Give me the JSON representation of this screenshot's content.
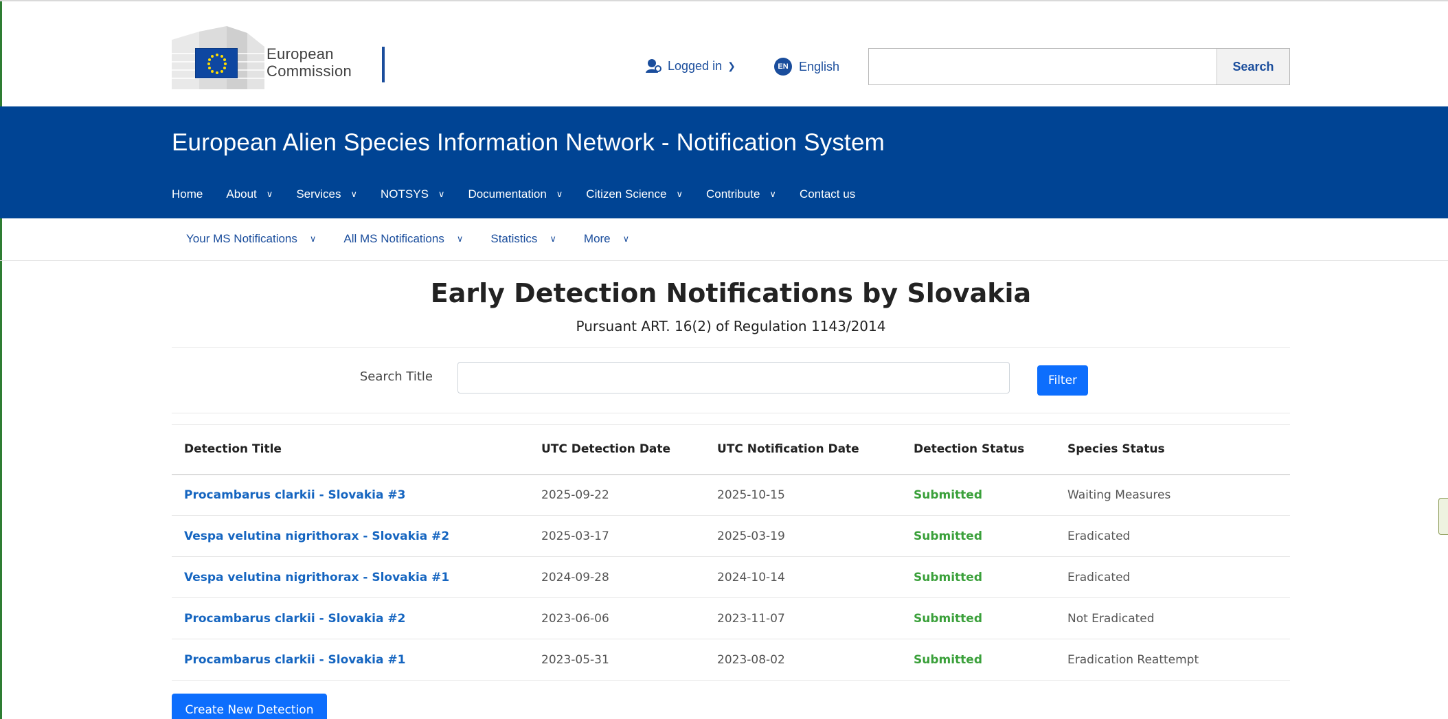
{
  "header": {
    "logo_text_line1": "European",
    "logo_text_line2": "Commission",
    "login_label": "Logged in",
    "lang_badge": "EN",
    "lang_label": "English",
    "search_placeholder": "",
    "search_button": "Search"
  },
  "band": {
    "site_title": "European Alien Species Information Network - Notification System",
    "nav": [
      {
        "label": "Home"
      },
      {
        "label": "About"
      },
      {
        "label": "Services"
      },
      {
        "label": "NOTSYS"
      },
      {
        "label": "Documentation"
      },
      {
        "label": "Citizen Science"
      },
      {
        "label": "Contribute"
      },
      {
        "label": "Contact us"
      }
    ]
  },
  "subnav": [
    {
      "label": "Your MS Notifications"
    },
    {
      "label": "All MS Notifications"
    },
    {
      "label": "Statistics"
    },
    {
      "label": "More"
    }
  ],
  "content": {
    "title": "Early Detection Notifications by Slovakia",
    "subtitle": "Pursuant ART. 16(2) of Regulation 1143/2014",
    "filter_label": "Search Title",
    "filter_placeholder": "",
    "filter_button": "Filter",
    "table": {
      "headers": [
        "Detection Title",
        "UTC Detection Date",
        "UTC Notification Date",
        "Detection Status",
        "Species Status"
      ],
      "rows": [
        [
          "Procambarus clarkii - Slovakia #3",
          "2025-09-22",
          "2025-10-15",
          "Submitted",
          "Waiting Measures"
        ],
        [
          "Vespa velutina nigrithorax - Slovakia #2",
          "2025-03-17",
          "2025-03-19",
          "Submitted",
          "Eradicated"
        ],
        [
          "Vespa velutina nigrithorax - Slovakia #1",
          "2024-09-28",
          "2024-10-14",
          "Submitted",
          "Eradicated"
        ],
        [
          "Procambarus clarkii - Slovakia #2",
          "2023-06-06",
          "2023-11-07",
          "Submitted",
          "Not Eradicated"
        ],
        [
          "Procambarus clarkii - Slovakia #1",
          "2023-05-31",
          "2023-08-02",
          "Submitted",
          "Eradication Reattempt"
        ]
      ]
    },
    "create_button": "Create New Detection"
  },
  "colors": {
    "band_blue": "#004494",
    "link_blue": "#1565c0",
    "button_blue": "#0d6efd",
    "status_green": "#3aa03a"
  }
}
